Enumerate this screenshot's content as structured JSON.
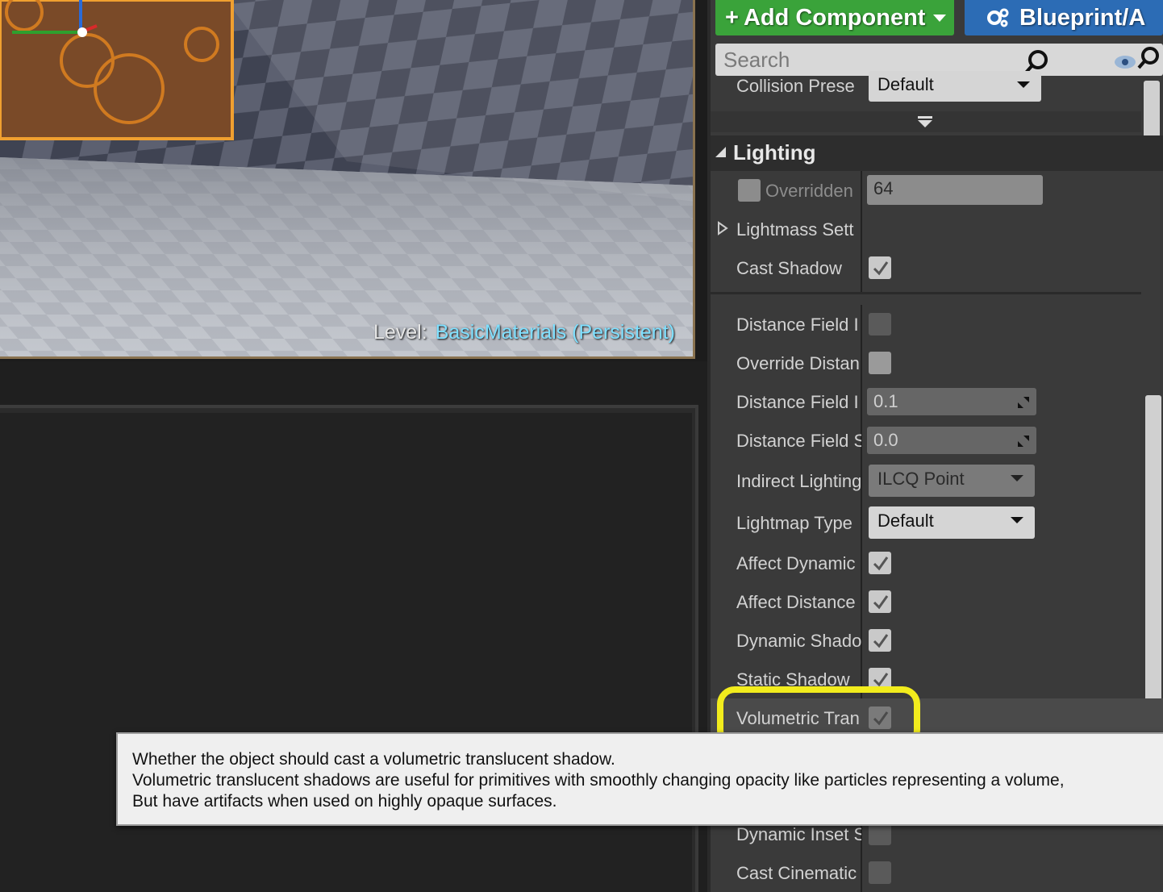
{
  "toolbar": {
    "add_component_label": "Add Component",
    "blueprint_label": "Blueprint/A"
  },
  "search": {
    "placeholder": "Search"
  },
  "viewport": {
    "level_label": "Level:",
    "level_name": "BasicMaterials (Persistent)"
  },
  "details": {
    "collision_row": {
      "label": "Collision Prese",
      "value": "Default"
    },
    "section_title": "Lighting",
    "rows": {
      "overridden": {
        "label": "Overridden",
        "value": "64"
      },
      "lightmass": {
        "label": "Lightmass Sett"
      },
      "cast_shadow": {
        "label": "Cast Shadow",
        "checked": true
      },
      "distance_field_1": {
        "label": "Distance Field I",
        "checked": false
      },
      "override_distance": {
        "label": "Override Distan",
        "checked": false
      },
      "distance_field_2": {
        "label": "Distance Field I",
        "value": "0.1"
      },
      "distance_field_3": {
        "label": "Distance Field S",
        "value": "0.0"
      },
      "indirect_lighting": {
        "label": "Indirect Lighting",
        "value": "ILCQ Point"
      },
      "lightmap_type": {
        "label": "Lightmap Type",
        "value": "Default"
      },
      "affect_dynamic": {
        "label": "Affect Dynamic",
        "checked": true
      },
      "affect_distance": {
        "label": "Affect Distance",
        "checked": true
      },
      "dynamic_shadow": {
        "label": "Dynamic Shado",
        "checked": true
      },
      "static_shadow": {
        "label": "Static Shadow",
        "checked": true
      },
      "volumetric": {
        "label": "Volumetric Tran",
        "checked": true
      },
      "dynamic_inset": {
        "label": "Dynamic Inset S",
        "checked": false
      },
      "cast_cinematic": {
        "label": "Cast Cinematic",
        "checked": false
      }
    }
  },
  "tooltip": {
    "line1": "Whether the object should cast a volumetric translucent shadow.",
    "line2": "Volumetric translucent shadows are useful for primitives with smoothly changing opacity like particles representing a volume,",
    "line3": "But have artifacts when used on highly opaque surfaces."
  },
  "colors": {
    "add_component": "#3aa33a",
    "blueprint": "#2c6cb5",
    "highlight": "#f2ec1d",
    "level_name": "#7fe0ff"
  }
}
